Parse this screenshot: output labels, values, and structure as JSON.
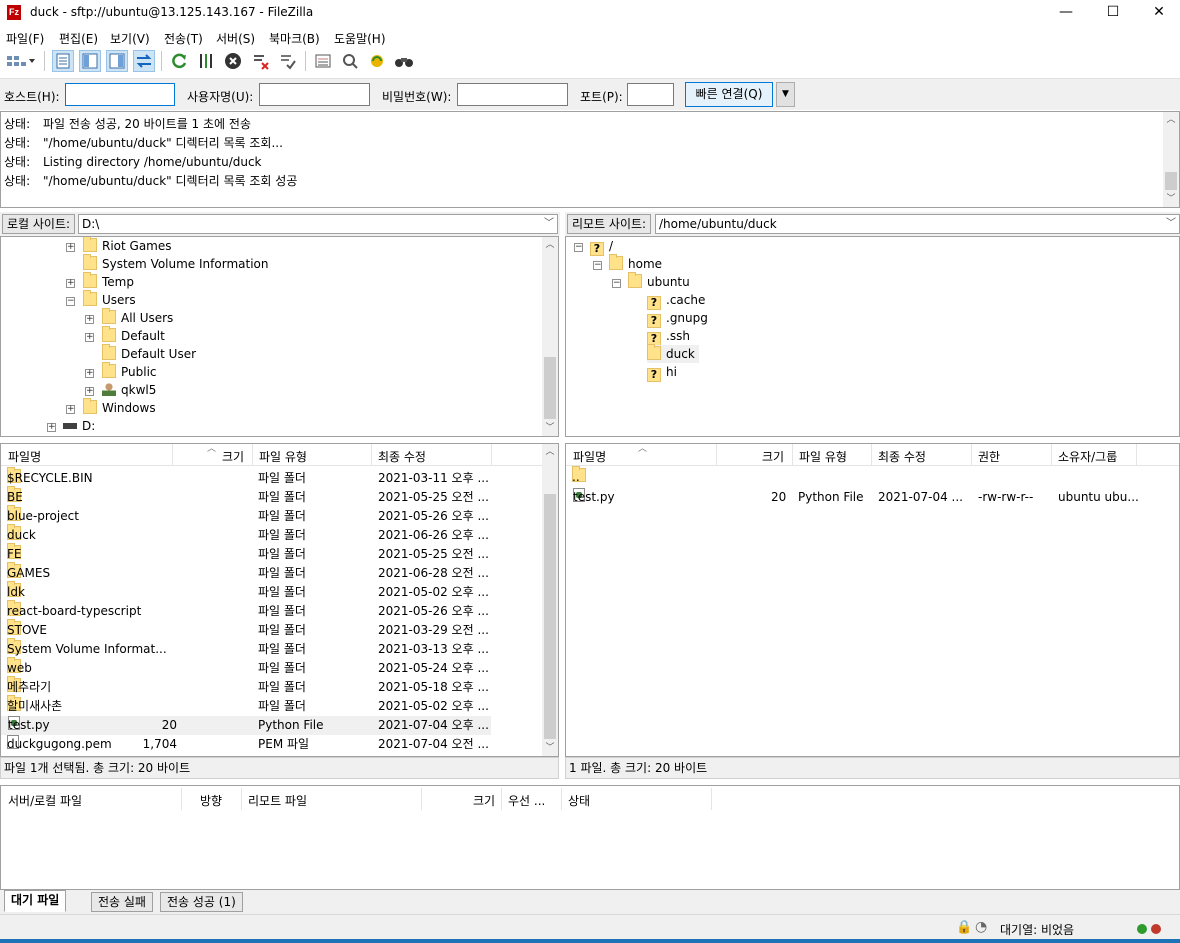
{
  "window": {
    "title": "duck - sftp://ubuntu@13.125.143.167 - FileZilla",
    "app_icon": "Fz",
    "minimize": "—",
    "maximize": "☐",
    "close": "✕"
  },
  "menu": [
    "파일(F)",
    "편집(E)",
    "보기(V)",
    "전송(T)",
    "서버(S)",
    "북마크(B)",
    "도움말(H)"
  ],
  "quickconnect": {
    "host_label": "호스트(H):",
    "host_value": "",
    "user_label": "사용자명(U):",
    "user_value": "",
    "pass_label": "비밀번호(W):",
    "pass_value": "",
    "port_label": "포트(P):",
    "port_value": "",
    "connect_label": "빠른 연결(Q)"
  },
  "log": [
    {
      "label": "상태:",
      "text": "파일 전송 성공, 20 바이트를 1 초에 전송"
    },
    {
      "label": "상태:",
      "text": "\"/home/ubuntu/duck\" 디렉터리 목록 조회..."
    },
    {
      "label": "상태:",
      "text": "Listing directory /home/ubuntu/duck"
    },
    {
      "label": "상태:",
      "text": "\"/home/ubuntu/duck\" 디렉터리 목록 조회 성공"
    }
  ],
  "local": {
    "site_label": "로컬 사이트:",
    "path": "D:\\",
    "tree": [
      {
        "label": "Riot Games"
      },
      {
        "label": "System Volume Information"
      },
      {
        "label": "Temp"
      },
      {
        "label": "Users"
      },
      {
        "label": "All Users"
      },
      {
        "label": "Default"
      },
      {
        "label": "Default User"
      },
      {
        "label": "Public"
      },
      {
        "label": "qkwl5"
      },
      {
        "label": "Windows"
      },
      {
        "label": "D:"
      }
    ],
    "columns": {
      "name": "파일명",
      "size": "크기",
      "type": "파일 유형",
      "modified": "최종 수정"
    },
    "files": [
      {
        "name": "$RECYCLE.BIN",
        "size": "",
        "type": "파일 폴더",
        "modified": "2021-03-11 오후 ..."
      },
      {
        "name": "BE",
        "size": "",
        "type": "파일 폴더",
        "modified": "2021-05-25 오전 ..."
      },
      {
        "name": "blue-project",
        "size": "",
        "type": "파일 폴더",
        "modified": "2021-05-26 오후 ..."
      },
      {
        "name": "duck",
        "size": "",
        "type": "파일 폴더",
        "modified": "2021-06-26 오후 ..."
      },
      {
        "name": "FE",
        "size": "",
        "type": "파일 폴더",
        "modified": "2021-05-25 오전 ..."
      },
      {
        "name": "GAMES",
        "size": "",
        "type": "파일 폴더",
        "modified": "2021-06-28 오전 ..."
      },
      {
        "name": "ldk",
        "size": "",
        "type": "파일 폴더",
        "modified": "2021-05-02 오후 ..."
      },
      {
        "name": "react-board-typescript",
        "size": "",
        "type": "파일 폴더",
        "modified": "2021-05-26 오후 ..."
      },
      {
        "name": "STOVE",
        "size": "",
        "type": "파일 폴더",
        "modified": "2021-03-29 오전 ..."
      },
      {
        "name": "System Volume Informat...",
        "size": "",
        "type": "파일 폴더",
        "modified": "2021-03-13 오후 ..."
      },
      {
        "name": "web",
        "size": "",
        "type": "파일 폴더",
        "modified": "2021-05-24 오후 ..."
      },
      {
        "name": "메추라기",
        "size": "",
        "type": "파일 폴더",
        "modified": "2021-05-18 오후 ..."
      },
      {
        "name": "할미새사촌",
        "size": "",
        "type": "파일 폴더",
        "modified": "2021-05-02 오후 ..."
      },
      {
        "name": "test.py",
        "size": "20",
        "type": "Python File",
        "modified": "2021-07-04 오후 ..."
      },
      {
        "name": "duckgugong.pem",
        "size": "1,704",
        "type": "PEM 파일",
        "modified": "2021-07-04 오전 ..."
      }
    ],
    "status": "파일 1개 선택됨. 총 크기: 20 바이트"
  },
  "remote": {
    "site_label": "리모트 사이트:",
    "path": "/home/ubuntu/duck",
    "tree": [
      {
        "label": "/"
      },
      {
        "label": "home"
      },
      {
        "label": "ubuntu"
      },
      {
        "label": ".cache"
      },
      {
        "label": ".gnupg"
      },
      {
        "label": ".ssh"
      },
      {
        "label": "duck"
      },
      {
        "label": "hi"
      }
    ],
    "columns": {
      "name": "파일명",
      "size": "크기",
      "type": "파일 유형",
      "modified": "최종 수정",
      "perms": "권한",
      "owner": "소유자/그룹"
    },
    "files": [
      {
        "name": "..",
        "size": "",
        "type": "",
        "modified": "",
        "perms": "",
        "owner": ""
      },
      {
        "name": "test.py",
        "size": "20",
        "type": "Python File",
        "modified": "2021-07-04 ...",
        "perms": "-rw-rw-r--",
        "owner": "ubuntu ubu..."
      }
    ],
    "status": "1 파일. 총 크기: 20 바이트"
  },
  "queue": {
    "columns": [
      "서버/로컬 파일",
      "방향",
      "리모트 파일",
      "크기",
      "우선 ...",
      "상태"
    ],
    "tabs": [
      "대기 파일",
      "전송 실패",
      "전송 성공 (1)"
    ]
  },
  "statusbar": {
    "queue": "대기열: 비었음"
  },
  "colors": {
    "highlight": "#ffff00",
    "accent": "#0078d7",
    "taskbar": "#1e72b6"
  }
}
